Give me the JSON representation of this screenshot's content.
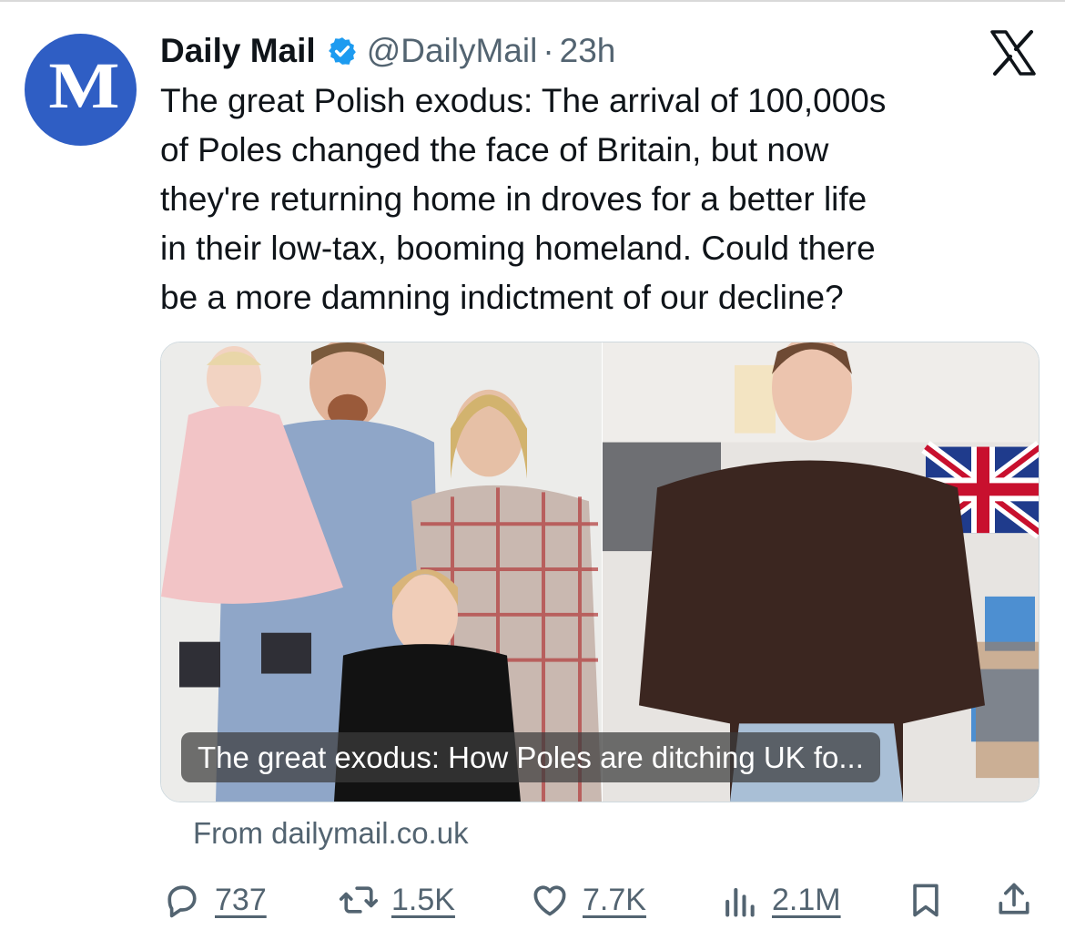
{
  "account": {
    "name": "Daily Mail",
    "handle": "@DailyMail",
    "separator": "·",
    "time": "23h",
    "avatar_letter": "M",
    "avatar_color": "#2f5ec4",
    "verified_color": "#1d9bf0"
  },
  "tweet": {
    "text": "The great Polish exodus: The arrival of 100,000s\nof Poles changed the face of Britain, but now\nthey're returning home in droves for a better life\nin their low-tax, booming homeland. Could there\nbe a more damning indictment of our decline?"
  },
  "card": {
    "caption": "The great exodus: How Poles are ditching UK fo...",
    "source": "From dailymail.co.uk",
    "left_image": "family-photo",
    "right_image": "woman-in-classroom-photo"
  },
  "actions": {
    "replies": "737",
    "reposts": "1.5K",
    "likes": "7.7K",
    "views": "2.1M"
  },
  "icons": [
    "verified-badge-icon",
    "x-logo-icon",
    "reply-icon",
    "repost-icon",
    "like-icon",
    "views-icon",
    "bookmark-icon",
    "share-icon"
  ]
}
